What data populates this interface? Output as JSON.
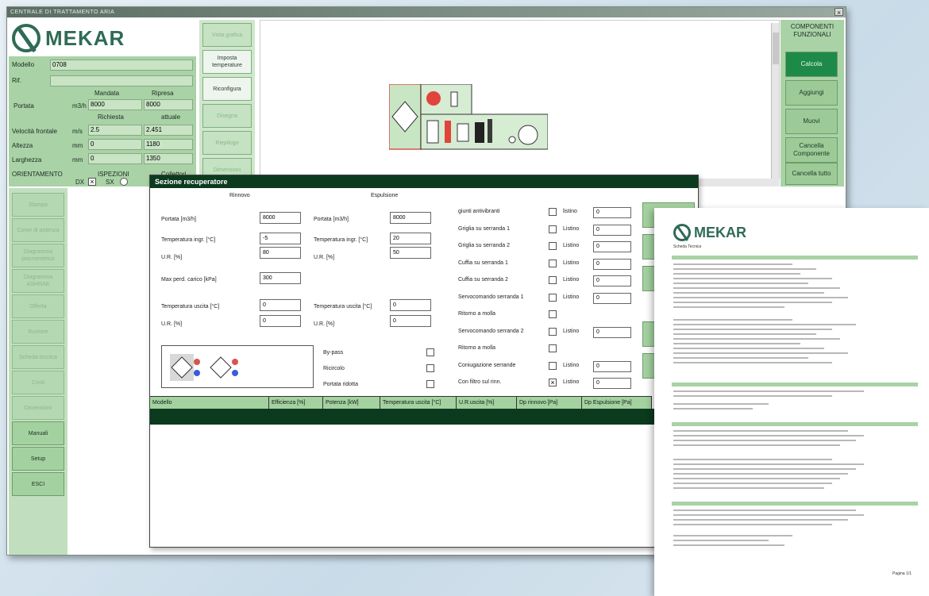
{
  "window": {
    "title": "CENTRALE DI TRATTAMENTO ARIA",
    "close": "×"
  },
  "brand": {
    "name": "MEKAR"
  },
  "form": {
    "modello_label": "Modello",
    "modello_value": "0708",
    "rif_label": "Rif.",
    "rif_value": "",
    "mandata_label": "Mandata",
    "ripresa_label": "Ripresa",
    "portata_label": "Portata",
    "portata_unit": "m3/h",
    "portata_mandata": "8000",
    "portata_ripresa": "8000",
    "richiesta_label": "Richiesta",
    "attuale_label": "attuale",
    "velocita_label": "Velocità frontale",
    "velocita_unit": "m/s",
    "velocita_richiesta": "2.5",
    "velocita_attuale": "2.451",
    "altezza_label": "Altezza",
    "altezza_unit": "mm",
    "altezza_richiesta": "0",
    "altezza_attuale": "1180",
    "larghezza_label": "Larghezza",
    "larghezza_unit": "mm",
    "larghezza_richiesta": "0",
    "larghezza_attuale": "1350",
    "orientamento_label": "ORIENTAMENTO",
    "ispezioni_label": "ISPEZIONI",
    "collettori_label": "Collettori",
    "dx_label": "DX",
    "sx_label": "SX"
  },
  "middle_buttons": [
    "Vista grafica",
    "Imposta temperature",
    "Riconfigura",
    "Disegna",
    "Riepilogo",
    "Dimensioni"
  ],
  "right_panel": {
    "title": "COMPONENTI FUNZIONALI",
    "buttons": [
      "Calcola",
      "Aggiungi",
      "Muovi",
      "Cancella Componente",
      "Cancella tutto"
    ]
  },
  "left_buttons": [
    "Stampa",
    "Curve di potenza",
    "Diagramma psicrometrico",
    "Diagramma ASHRAE",
    "Offerta",
    "Rumore",
    "Scheda tecnica",
    "Costi",
    "Dimensioni",
    "Manuali",
    "Setup",
    "ESCI"
  ],
  "dialog": {
    "title": "Sezione recuperatore",
    "rinnovo": "Rinnovo",
    "espulsione": "Espulsione",
    "portata_label": "Portata [m3/h]",
    "portata_rinnovo": "8000",
    "portata_espulsione": "8000",
    "temp_ingr_label": "Temperatura ingr. [°C]",
    "temp_ingr_rinnovo": "-5",
    "temp_ingr_espulsione": "20",
    "ur_label": "U.R. [%]",
    "ur_rinnovo": "80",
    "ur_espulsione": "50",
    "perdita_label": "Max perd. carico [kPa]",
    "perdita_value": "300",
    "temp_usc_label": "Temperatura uscita [°C]",
    "temp_usc_rinnovo": "0",
    "temp_usc_espulsione": "0",
    "ur_usc_rinnovo": "0",
    "ur_usc_espulsione": "0",
    "bypass": "By-pass",
    "ricircolo": "Ricircolo",
    "portata_ridotta": "Portata ridotta",
    "options": [
      {
        "label": "giunti antivibranti",
        "price_label": "listino",
        "value": "0",
        "checked": false
      },
      {
        "label": "Griglia su serranda 1",
        "price_label": "Listino",
        "value": "0",
        "checked": false
      },
      {
        "label": "Griglia su serranda 2",
        "price_label": "Listino",
        "value": "0",
        "checked": false
      },
      {
        "label": "Cuffia su serranda 1",
        "price_label": "Listino",
        "value": "0",
        "checked": false
      },
      {
        "label": "Cuffia su serranda 2",
        "price_label": "Listino",
        "value": "0",
        "checked": false
      },
      {
        "label": "Servocomando serranda 1",
        "price_label": "Listino",
        "value": "0",
        "checked": false
      },
      {
        "label": "Ritorno a molla",
        "price_label": "",
        "value": "",
        "checked": false
      },
      {
        "label": "Servocomando serranda 2",
        "price_label": "Listino",
        "value": "0",
        "checked": false
      },
      {
        "label": "Ritorno a molla",
        "price_label": "",
        "value": "",
        "checked": false
      },
      {
        "label": "Coniugazione serrande",
        "price_label": "Listino",
        "value": "0",
        "checked": false
      },
      {
        "label": "Con filtro sul rinn.",
        "price_label": "Listino",
        "value": "0",
        "checked": true
      }
    ],
    "table_headers": [
      "Modello",
      "Efficienza [%]",
      "Potenza [kW]",
      "Temperatura uscita [°C]",
      "U.R.uscita [%]",
      "Dp rinnovo [Pa]",
      "Dp Espulsione [Pa]"
    ]
  },
  "report": {
    "brand": "MEKAR",
    "subtitle": "Scheda Tecnica",
    "page": "Pagina 1/1"
  },
  "colors": {
    "brand_green": "#2f6b55",
    "panel_green": "#a9d2a6",
    "dark_green": "#0b3a1e",
    "accent": "#1e8a4a"
  }
}
